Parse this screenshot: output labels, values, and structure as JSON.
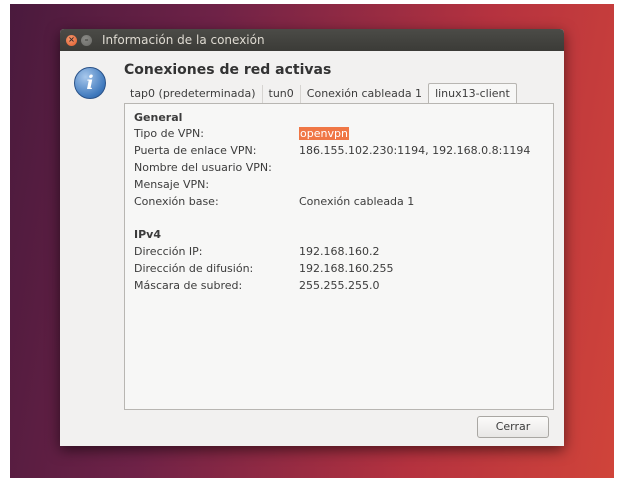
{
  "window": {
    "title": "Información de la conexión",
    "heading": "Conexiones de red activas",
    "icon": "info-icon"
  },
  "tabs": [
    {
      "label": "tap0 (predeterminada)"
    },
    {
      "label": "tun0"
    },
    {
      "label": "Conexión cableada 1"
    },
    {
      "label": "linux13-client"
    }
  ],
  "active_tab": "linux13-client",
  "general": {
    "title": "General",
    "rows": [
      {
        "label": "Tipo de VPN:",
        "value": "openvpn"
      },
      {
        "label": "Puerta de enlace VPN:",
        "value": "186.155.102.230:1194, 192.168.0.8:1194"
      },
      {
        "label": "Nombre del usuario VPN:",
        "value": ""
      },
      {
        "label": "Mensaje VPN:",
        "value": ""
      },
      {
        "label": "Conexión base:",
        "value": "Conexión cableada 1"
      }
    ]
  },
  "ipv4": {
    "title": "IPv4",
    "rows": [
      {
        "label": "Dirección IP:",
        "value": "192.168.160.2"
      },
      {
        "label": "Dirección de difusión:",
        "value": "192.168.160.255"
      },
      {
        "label": "Máscara de subred:",
        "value": "255.255.255.0"
      }
    ]
  },
  "buttons": {
    "close": "Cerrar"
  },
  "colors": {
    "selection": "#f07746",
    "titlebar": "#3b3b37",
    "window_bg": "#f2f1f0"
  }
}
